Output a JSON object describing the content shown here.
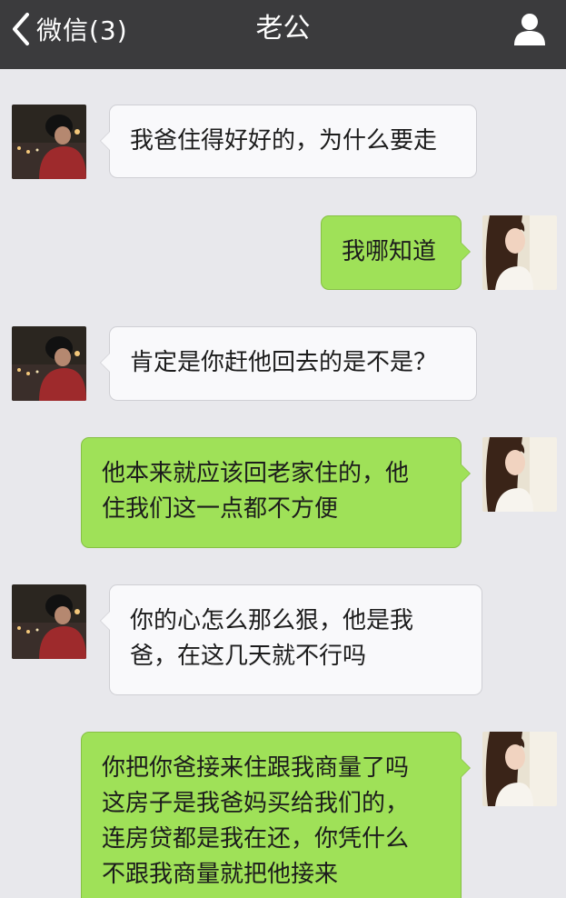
{
  "header": {
    "back_label": "微信(3)",
    "title": "老公"
  },
  "colors": {
    "topbar": "#3b3b3d",
    "background": "#e8e8ec",
    "incoming_bubble": "#f9f9fb",
    "outgoing_bubble": "#9fe158"
  },
  "icons": {
    "back": "chevron-left-icon",
    "profile": "person-icon"
  },
  "messages": [
    {
      "from": "contact",
      "lines": [
        "我爸住得好好的，为什么要走"
      ]
    },
    {
      "from": "me",
      "lines": [
        "我哪知道"
      ]
    },
    {
      "from": "contact",
      "lines": [
        "肯定是你赶他回去的是不是？"
      ]
    },
    {
      "from": "me",
      "lines": [
        "他本来就应该回老家住的，他",
        "住我们这一点都不方便"
      ]
    },
    {
      "from": "contact",
      "lines": [
        "你的心怎么那么狠，他是我",
        "爸，在这几天就不行吗"
      ]
    },
    {
      "from": "me",
      "lines": [
        "你把你爸接来住跟我商量了吗",
        "这房子是我爸妈买给我们的，",
        "连房贷都是我在还，你凭什么",
        "不跟我商量就把他接来"
      ]
    }
  ]
}
